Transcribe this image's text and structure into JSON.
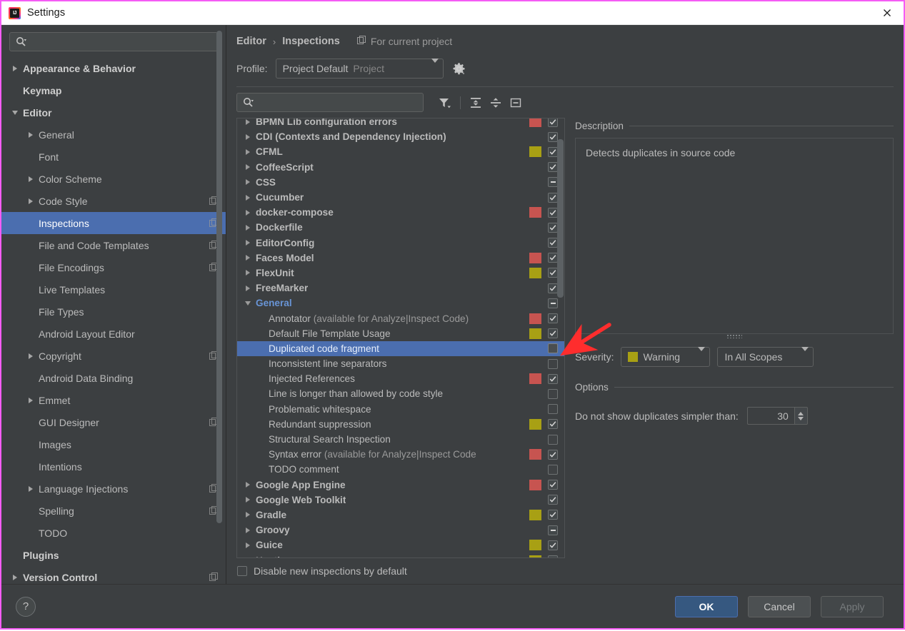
{
  "window": {
    "title": "Settings",
    "close_icon": "close-icon",
    "accent_blue": "#4b6eaf",
    "border_color": "#f55cf5"
  },
  "sidebar": {
    "search": {
      "placeholder": "",
      "value": "",
      "icon": "search-icon"
    },
    "items": [
      {
        "label": "Appearance & Behavior",
        "indent": 0,
        "arrow": "right",
        "bold": true,
        "copy": false,
        "selected": false
      },
      {
        "label": "Keymap",
        "indent": 0,
        "arrow": "none",
        "bold": true,
        "copy": false,
        "selected": false
      },
      {
        "label": "Editor",
        "indent": 0,
        "arrow": "down",
        "bold": true,
        "copy": false,
        "selected": false
      },
      {
        "label": "General",
        "indent": 1,
        "arrow": "right",
        "bold": false,
        "copy": false,
        "selected": false
      },
      {
        "label": "Font",
        "indent": 1,
        "arrow": "none",
        "bold": false,
        "copy": false,
        "selected": false
      },
      {
        "label": "Color Scheme",
        "indent": 1,
        "arrow": "right",
        "bold": false,
        "copy": false,
        "selected": false
      },
      {
        "label": "Code Style",
        "indent": 1,
        "arrow": "right",
        "bold": false,
        "copy": true,
        "selected": false
      },
      {
        "label": "Inspections",
        "indent": 1,
        "arrow": "none",
        "bold": false,
        "copy": true,
        "selected": true
      },
      {
        "label": "File and Code Templates",
        "indent": 1,
        "arrow": "none",
        "bold": false,
        "copy": true,
        "selected": false
      },
      {
        "label": "File Encodings",
        "indent": 1,
        "arrow": "none",
        "bold": false,
        "copy": true,
        "selected": false
      },
      {
        "label": "Live Templates",
        "indent": 1,
        "arrow": "none",
        "bold": false,
        "copy": false,
        "selected": false
      },
      {
        "label": "File Types",
        "indent": 1,
        "arrow": "none",
        "bold": false,
        "copy": false,
        "selected": false
      },
      {
        "label": "Android Layout Editor",
        "indent": 1,
        "arrow": "none",
        "bold": false,
        "copy": false,
        "selected": false
      },
      {
        "label": "Copyright",
        "indent": 1,
        "arrow": "right",
        "bold": false,
        "copy": true,
        "selected": false
      },
      {
        "label": "Android Data Binding",
        "indent": 1,
        "arrow": "none",
        "bold": false,
        "copy": false,
        "selected": false
      },
      {
        "label": "Emmet",
        "indent": 1,
        "arrow": "right",
        "bold": false,
        "copy": false,
        "selected": false
      },
      {
        "label": "GUI Designer",
        "indent": 1,
        "arrow": "none",
        "bold": false,
        "copy": true,
        "selected": false
      },
      {
        "label": "Images",
        "indent": 1,
        "arrow": "none",
        "bold": false,
        "copy": false,
        "selected": false
      },
      {
        "label": "Intentions",
        "indent": 1,
        "arrow": "none",
        "bold": false,
        "copy": false,
        "selected": false
      },
      {
        "label": "Language Injections",
        "indent": 1,
        "arrow": "right",
        "bold": false,
        "copy": true,
        "selected": false
      },
      {
        "label": "Spelling",
        "indent": 1,
        "arrow": "none",
        "bold": false,
        "copy": true,
        "selected": false
      },
      {
        "label": "TODO",
        "indent": 1,
        "arrow": "none",
        "bold": false,
        "copy": false,
        "selected": false
      },
      {
        "label": "Plugins",
        "indent": 0,
        "arrow": "none",
        "bold": true,
        "copy": false,
        "selected": false
      },
      {
        "label": "Version Control",
        "indent": 0,
        "arrow": "right",
        "bold": true,
        "copy": true,
        "selected": false
      }
    ]
  },
  "header": {
    "breadcrumb_parent": "Editor",
    "breadcrumb_sep": "›",
    "breadcrumb_current": "Inspections",
    "for_current_project": "For current project",
    "for_current_project_icon": "copy-icon",
    "profile_label": "Profile:",
    "profile_value": "Project Default",
    "profile_scope": "Project",
    "gear_icon": "gear-icon"
  },
  "toolbar": {
    "search": {
      "placeholder": "",
      "value": "",
      "icon": "search-icon"
    },
    "filter_icon": "filter-icon",
    "expand_all_icon": "expand-all-icon",
    "collapse_all_icon": "collapse-all-icon",
    "reset_icon": "reset-box-icon"
  },
  "tree": {
    "rows": [
      {
        "label": "BPMN Lib configuration errors",
        "group": true,
        "arrow": "right",
        "severity": "#c75450",
        "check": "checked",
        "selected": false,
        "clipped": true
      },
      {
        "label": "CDI (Contexts and Dependency Injection)",
        "group": true,
        "arrow": "right",
        "severity": "",
        "check": "checked",
        "selected": false
      },
      {
        "label": "CFML",
        "group": true,
        "arrow": "right",
        "severity": "#a8a014",
        "check": "checked",
        "selected": false
      },
      {
        "label": "CoffeeScript",
        "group": true,
        "arrow": "right",
        "severity": "",
        "check": "checked",
        "selected": false
      },
      {
        "label": "CSS",
        "group": true,
        "arrow": "right",
        "severity": "",
        "check": "partial",
        "selected": false
      },
      {
        "label": "Cucumber",
        "group": true,
        "arrow": "right",
        "severity": "",
        "check": "checked",
        "selected": false
      },
      {
        "label": "docker-compose",
        "group": true,
        "arrow": "right",
        "severity": "#c75450",
        "check": "checked",
        "selected": false
      },
      {
        "label": "Dockerfile",
        "group": true,
        "arrow": "right",
        "severity": "",
        "check": "checked",
        "selected": false
      },
      {
        "label": "EditorConfig",
        "group": true,
        "arrow": "right",
        "severity": "",
        "check": "checked",
        "selected": false
      },
      {
        "label": "Faces Model",
        "group": true,
        "arrow": "right",
        "severity": "#c75450",
        "check": "checked",
        "selected": false
      },
      {
        "label": "FlexUnit",
        "group": true,
        "arrow": "right",
        "severity": "#a8a014",
        "check": "checked",
        "selected": false
      },
      {
        "label": "FreeMarker",
        "group": true,
        "arrow": "right",
        "severity": "",
        "check": "checked",
        "selected": false
      },
      {
        "label": "General",
        "group": true,
        "arrow": "down",
        "severity": "",
        "check": "partial",
        "selected": false,
        "highlight": true
      },
      {
        "label": "Annotator",
        "sublabel": " (available for Analyze|Inspect Code)",
        "group": false,
        "arrow": "none",
        "severity": "#c75450",
        "check": "checked",
        "selected": false
      },
      {
        "label": "Default File Template Usage",
        "group": false,
        "arrow": "none",
        "severity": "#a8a014",
        "check": "checked",
        "selected": false
      },
      {
        "label": "Duplicated code fragment",
        "group": false,
        "arrow": "none",
        "severity": "",
        "check": "unchecked-dark",
        "selected": true
      },
      {
        "label": "Inconsistent line separators",
        "group": false,
        "arrow": "none",
        "severity": "",
        "check": "unchecked",
        "selected": false
      },
      {
        "label": "Injected References",
        "group": false,
        "arrow": "none",
        "severity": "#c75450",
        "check": "checked",
        "selected": false
      },
      {
        "label": "Line is longer than allowed by code style",
        "group": false,
        "arrow": "none",
        "severity": "",
        "check": "unchecked",
        "selected": false
      },
      {
        "label": "Problematic whitespace",
        "group": false,
        "arrow": "none",
        "severity": "",
        "check": "unchecked",
        "selected": false
      },
      {
        "label": "Redundant suppression",
        "group": false,
        "arrow": "none",
        "severity": "#a8a014",
        "check": "checked",
        "selected": false
      },
      {
        "label": "Structural Search Inspection",
        "group": false,
        "arrow": "none",
        "severity": "",
        "check": "unchecked",
        "selected": false
      },
      {
        "label": "Syntax error",
        "sublabel": " (available for Analyze|Inspect Code",
        "group": false,
        "arrow": "none",
        "severity": "#c75450",
        "check": "checked",
        "selected": false
      },
      {
        "label": "TODO comment",
        "group": false,
        "arrow": "none",
        "severity": "",
        "check": "unchecked",
        "selected": false
      },
      {
        "label": "Google App Engine",
        "group": true,
        "arrow": "right",
        "severity": "#c75450",
        "check": "checked",
        "selected": false
      },
      {
        "label": "Google Web Toolkit",
        "group": true,
        "arrow": "right",
        "severity": "",
        "check": "checked",
        "selected": false
      },
      {
        "label": "Gradle",
        "group": true,
        "arrow": "right",
        "severity": "#a8a014",
        "check": "checked",
        "selected": false
      },
      {
        "label": "Groovy",
        "group": true,
        "arrow": "right",
        "severity": "",
        "check": "partial",
        "selected": false
      },
      {
        "label": "Guice",
        "group": true,
        "arrow": "right",
        "severity": "#a8a014",
        "check": "checked",
        "selected": false
      },
      {
        "label": "Hosting",
        "group": true,
        "arrow": "right",
        "severity": "#a8a014",
        "check": "checked",
        "selected": false,
        "clipped_bottom": true
      }
    ],
    "disable_new_label": "Disable new inspections by default",
    "disable_new_checked": false
  },
  "details": {
    "description_label": "Description",
    "description_text": "Detects duplicates in source code",
    "severity_label": "Severity:",
    "severity_value": "Warning",
    "severity_color": "#a8a014",
    "scope_value": "In All Scopes",
    "options_label": "Options",
    "option_label": "Do not show duplicates simpler than:",
    "option_value": "30"
  },
  "footer": {
    "help_label": "?",
    "ok_label": "OK",
    "cancel_label": "Cancel",
    "apply_label": "Apply",
    "apply_disabled": true
  }
}
